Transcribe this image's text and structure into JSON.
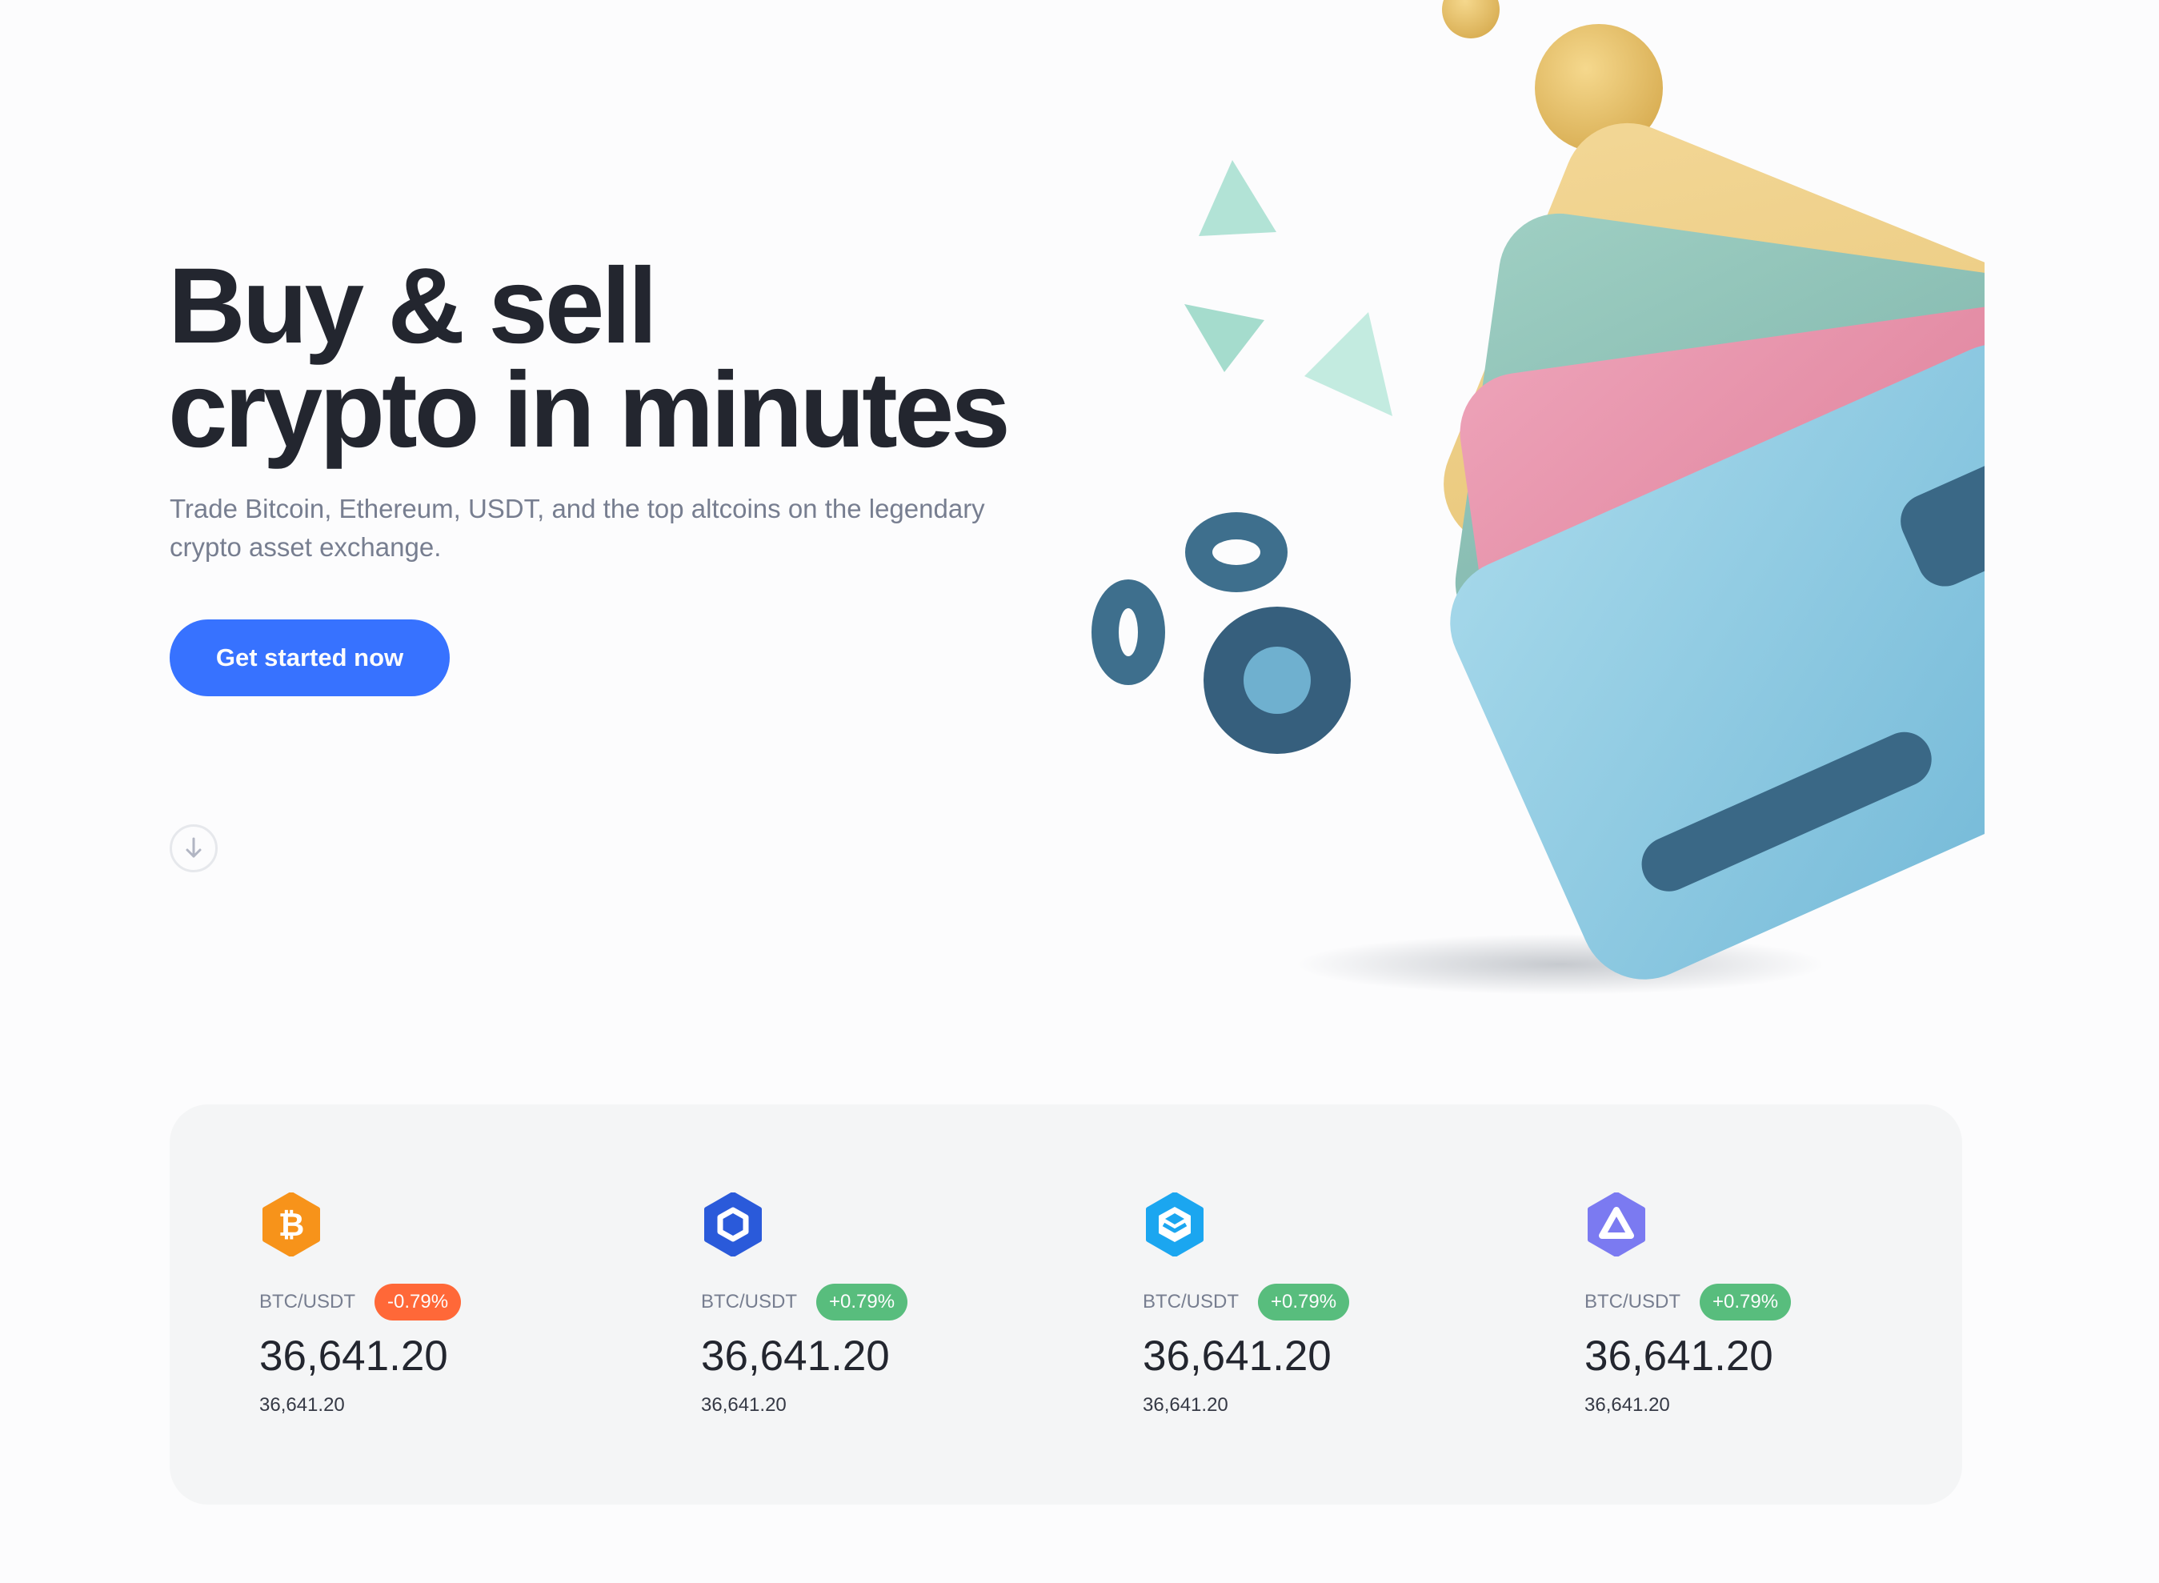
{
  "hero": {
    "title_line1": "Buy & sell",
    "title_line2": "crypto in minutes",
    "subtitle": "Trade Bitcoin, Ethereum, USDT, and the top altcoins on the legendary crypto asset exchange.",
    "cta_label": "Get started now",
    "scroll_icon": "arrow-down-icon"
  },
  "colors": {
    "primary": "#3772ff",
    "negative": "#ff6838",
    "positive": "#58bd7d",
    "text_dark": "#23262f",
    "text_muted": "#777e90",
    "panel_bg": "#f4f5f6"
  },
  "markets": [
    {
      "icon": "bitcoin-icon",
      "icon_color": "#f7931a",
      "pair": "BTC/USDT",
      "change": "-0.79%",
      "change_color": "#ff6838",
      "price": "36,641.20",
      "price_sub": "36,641.20"
    },
    {
      "icon": "chainlink-icon",
      "icon_color": "#2a5ada",
      "pair": "BTC/USDT",
      "change": "+0.79%",
      "change_color": "#58bd7d",
      "price": "36,641.20",
      "price_sub": "36,641.20"
    },
    {
      "icon": "cube-token-icon",
      "icon_color": "#1ba6f0",
      "pair": "BTC/USDT",
      "change": "+0.79%",
      "change_color": "#58bd7d",
      "price": "36,641.20",
      "price_sub": "36,641.20"
    },
    {
      "icon": "triangle-token-icon",
      "icon_color": "#7b7af1",
      "pair": "BTC/USDT",
      "change": "+0.79%",
      "change_color": "#58bd7d",
      "price": "36,641.20",
      "price_sub": "36,641.20"
    }
  ]
}
